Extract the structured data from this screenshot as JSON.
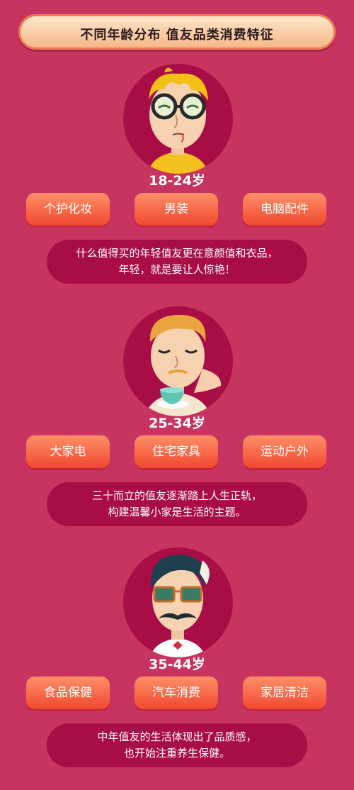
{
  "banner": {
    "title": "不同年龄分布 值友品类消费特征"
  },
  "groups": [
    {
      "age": "18-24岁",
      "tags": [
        "个护化妆",
        "男装",
        "电脑配件"
      ],
      "desc": [
        "什么值得买的年轻值友更在意颜值和衣品，",
        "年轻，就是要让人惊艳！"
      ]
    },
    {
      "age": "25-34岁",
      "tags": [
        "大家电",
        "住宅家具",
        "运动户外"
      ],
      "desc": [
        "三十而立的值友逐渐踏上人生正轨，",
        "构建温馨小家是生活的主题。"
      ]
    },
    {
      "age": "35-44岁",
      "tags": [
        "食品保健",
        "汽车消费",
        "家居清洁"
      ],
      "desc": [
        "中年值友的生活体现出了品质感，",
        "也开始注重养生保健。"
      ]
    }
  ]
}
